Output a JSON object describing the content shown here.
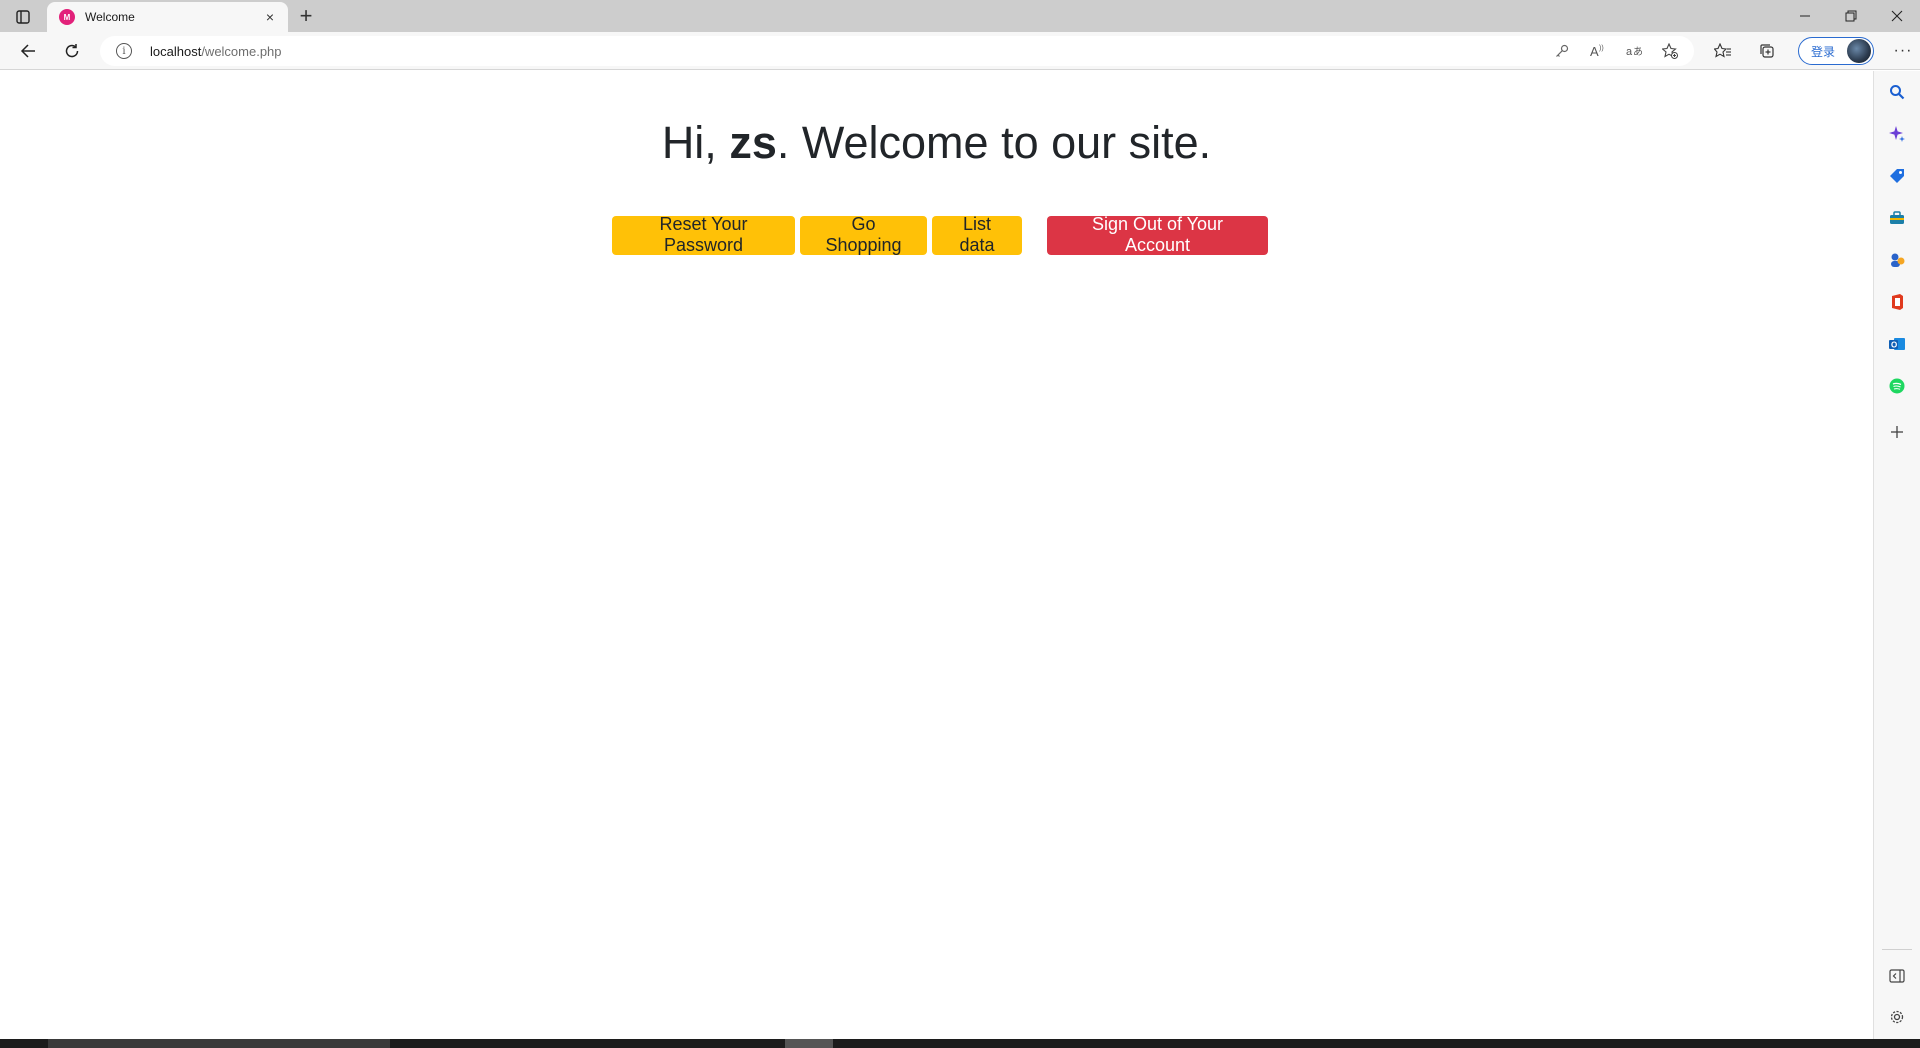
{
  "browser": {
    "tab": {
      "title": "Welcome",
      "favicon_text": "M",
      "close_glyph": "×"
    },
    "new_tab_glyph": "+",
    "window_controls": {
      "minimize": "–",
      "restore": "❐",
      "close": "✕"
    },
    "address": {
      "host": "localhost",
      "path": "/welcome.php"
    },
    "address_icons": [
      "key-icon",
      "read-aloud-icon",
      "translate-icon",
      "add-favorite-icon"
    ],
    "toolbar_icons": [
      "favorites-icon",
      "collections-icon"
    ],
    "signin_label": "登录",
    "more_glyph": "···"
  },
  "page": {
    "greeting_prefix": "Hi, ",
    "username": "zs",
    "greeting_suffix": ". Welcome to our site.",
    "buttons": {
      "reset_password": "Reset Your Password",
      "go_shopping": "Go Shopping",
      "list_data": "List data",
      "sign_out": "Sign Out of Your Account"
    }
  },
  "sidebar": {
    "icons": [
      "search-icon",
      "copilot-icon",
      "shopping-icon",
      "tools-icon",
      "games-icon",
      "office-icon",
      "outlook-icon",
      "spotify-icon",
      "add-icon"
    ],
    "bottom_icons": [
      "sidebar-toggle-icon",
      "settings-icon"
    ]
  },
  "colors": {
    "warning": "#ffc107",
    "danger": "#dc3545",
    "text": "#212529"
  }
}
